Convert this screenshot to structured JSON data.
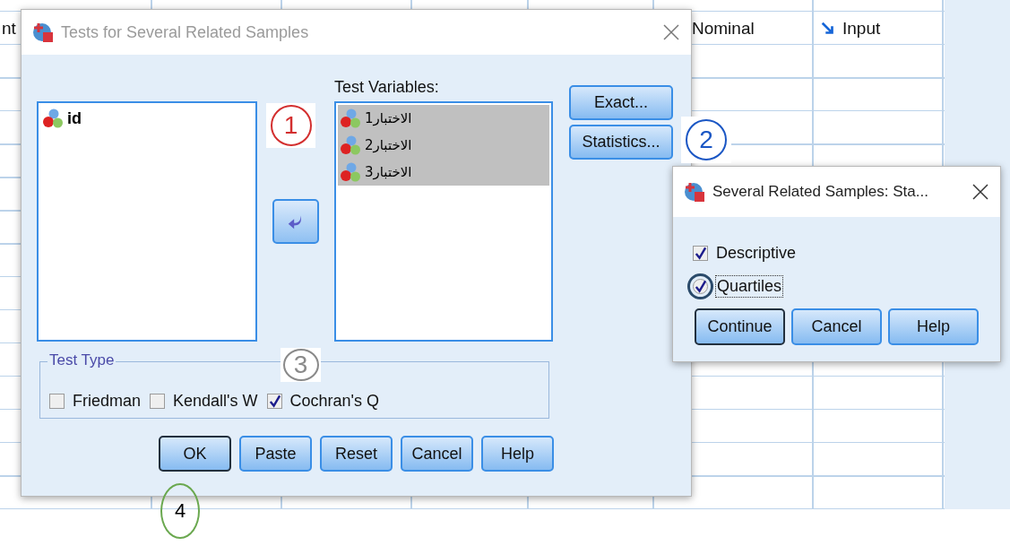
{
  "sheet": {
    "label_cell": "nt",
    "measure_cell": "Nominal",
    "role_cell": "Input"
  },
  "dialog": {
    "title": "Tests for Several Related Samples",
    "active": false,
    "source_list": {
      "items": [
        {
          "name": "id",
          "selected": false
        }
      ]
    },
    "test_variables": {
      "label": "Test Variables:",
      "items": [
        {
          "name": "الاختبار1",
          "selected": true
        },
        {
          "name": "الاختبار2",
          "selected": true
        },
        {
          "name": "الاختبار3",
          "selected": true
        }
      ]
    },
    "side_buttons": [
      {
        "label": "Exact..."
      },
      {
        "label": "Statistics..."
      }
    ],
    "test_type": {
      "legend": "Test Type",
      "options": [
        {
          "label": "Friedman",
          "checked": false
        },
        {
          "label": "Kendall's W",
          "checked": false
        },
        {
          "label": "Cochran's Q",
          "checked": true
        }
      ]
    },
    "buttons": [
      {
        "label": "OK",
        "default": true
      },
      {
        "label": "Paste",
        "default": false
      },
      {
        "label": "Reset",
        "default": false
      },
      {
        "label": "Cancel",
        "default": false
      },
      {
        "label": "Help",
        "default": false
      }
    ]
  },
  "stats_dialog": {
    "title": "Several Related Samples: Sta...",
    "active": true,
    "options": [
      {
        "label": "Descriptive",
        "checked": true,
        "focused": false
      },
      {
        "label": "Quartiles",
        "checked": true,
        "focused": true
      }
    ],
    "buttons": [
      {
        "label": "Continue",
        "default": true
      },
      {
        "label": "Cancel",
        "default": false
      },
      {
        "label": "Help",
        "default": false
      }
    ]
  },
  "annotations": [
    {
      "text": "1",
      "kind": "circle",
      "color": "#d32f2f"
    },
    {
      "text": "2",
      "kind": "circle",
      "color": "#1a56c4"
    },
    {
      "text": "3",
      "kind": "circle",
      "color": "#8a8a8a"
    },
    {
      "text": "4",
      "kind": "oval",
      "color": "#6aa84f"
    }
  ]
}
